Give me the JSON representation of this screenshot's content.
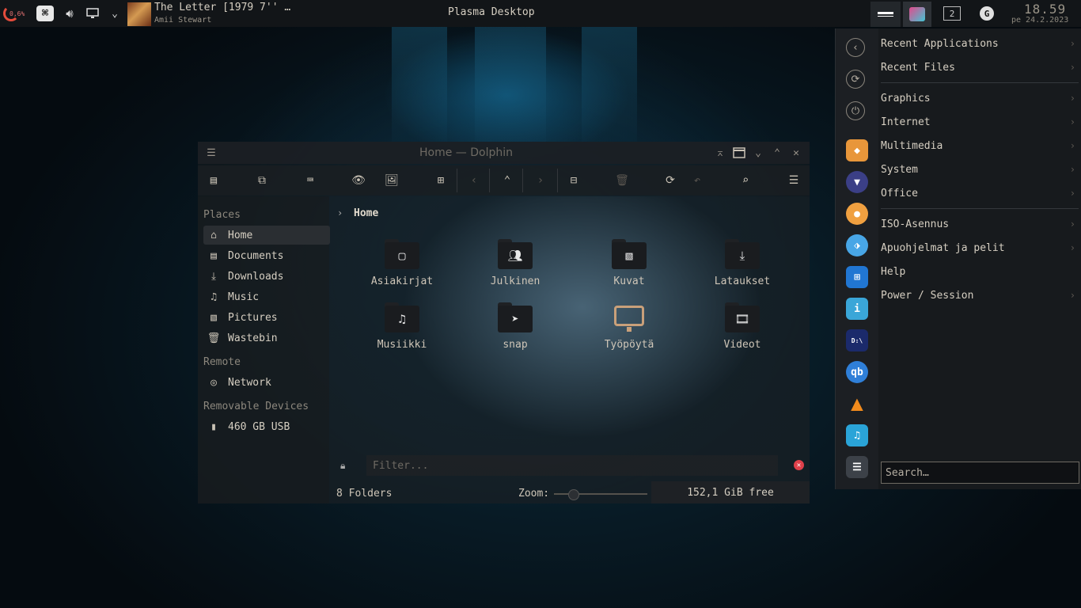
{
  "panel": {
    "cpu_label": "0,6%",
    "media_title": "The Letter [1979 7'' …",
    "media_artist": "Amii Stewart",
    "center_title": "Plasma Desktop",
    "desktop_number": "2",
    "clock_time": "18.59",
    "clock_date": "pe 24.2.2023"
  },
  "window": {
    "title": "Home — Dolphin",
    "breadcrumb": "Home",
    "places": {
      "heading": "Places",
      "items": [
        {
          "label": "Home",
          "icon": "home-icon"
        },
        {
          "label": "Documents",
          "icon": "documents-icon"
        },
        {
          "label": "Downloads",
          "icon": "downloads-icon"
        },
        {
          "label": "Music",
          "icon": "music-icon"
        },
        {
          "label": "Pictures",
          "icon": "pictures-icon"
        },
        {
          "label": "Wastebin",
          "icon": "trash-icon"
        }
      ],
      "remote_heading": "Remote",
      "remote_items": [
        {
          "label": "Network",
          "icon": "network-icon"
        }
      ],
      "removable_heading": "Removable Devices",
      "removable_items": [
        {
          "label": "460 GB USB",
          "icon": "usb-drive-icon"
        }
      ]
    },
    "folders": [
      {
        "label": "Asiakirjat",
        "icon": "document-folder-icon"
      },
      {
        "label": "Julkinen",
        "icon": "public-folder-icon"
      },
      {
        "label": "Kuvat",
        "icon": "pictures-folder-icon"
      },
      {
        "label": "Lataukset",
        "icon": "downloads-folder-icon"
      },
      {
        "label": "Musiikki",
        "icon": "music-folder-icon"
      },
      {
        "label": "snap",
        "icon": "snap-folder-icon"
      },
      {
        "label": "Työpöytä",
        "icon": "desktop-folder-icon"
      },
      {
        "label": "Videot",
        "icon": "videos-folder-icon"
      }
    ],
    "filter_placeholder": "Filter...",
    "status_count": "8 Folders",
    "zoom_label": "Zoom:",
    "zoom_level": 0.2,
    "free_space": "152,1 GiB free"
  },
  "launcher": {
    "menu": [
      {
        "label": "Recent Applications",
        "submenu": true
      },
      {
        "label": "Recent Files",
        "submenu": true
      },
      {
        "label": "Graphics",
        "submenu": true
      },
      {
        "label": "Internet",
        "submenu": true
      },
      {
        "label": "Multimedia",
        "submenu": true
      },
      {
        "label": "System",
        "submenu": true
      },
      {
        "label": "Office",
        "submenu": true
      },
      {
        "label": "ISO-Asennus",
        "submenu": true
      },
      {
        "label": "Apuohjelmat ja pelit",
        "submenu": true
      },
      {
        "label": "Help",
        "submenu": false
      },
      {
        "label": "Power / Session",
        "submenu": true
      }
    ],
    "search_placeholder": "Search…",
    "favorites": [
      "back-icon",
      "refresh-icon",
      "power-icon",
      "app-icon",
      "brave-icon",
      "app-icon",
      "tag-icon",
      "store-icon",
      "info-icon",
      "terminal-icon",
      "qbittorrent-icon",
      "vlc-icon",
      "music-app-icon",
      "settings-icon"
    ]
  }
}
